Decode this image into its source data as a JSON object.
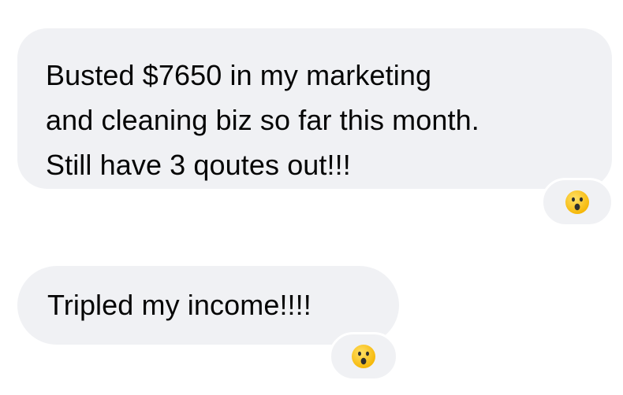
{
  "messages": [
    {
      "lines": [
        "Busted $7650 in my marketing",
        "and cleaning biz so far this month.",
        "Still have 3 qoutes out!!!"
      ],
      "reaction": "surprised-face-icon"
    },
    {
      "lines": [
        "Tripled my income!!!!"
      ],
      "reaction": "surprised-face-icon"
    }
  ],
  "colors": {
    "background": "#ffffff",
    "bubble": "#f0f1f4",
    "text": "#050505",
    "emoji_face": "#fcc21b",
    "emoji_features": "#2f2f2f"
  }
}
